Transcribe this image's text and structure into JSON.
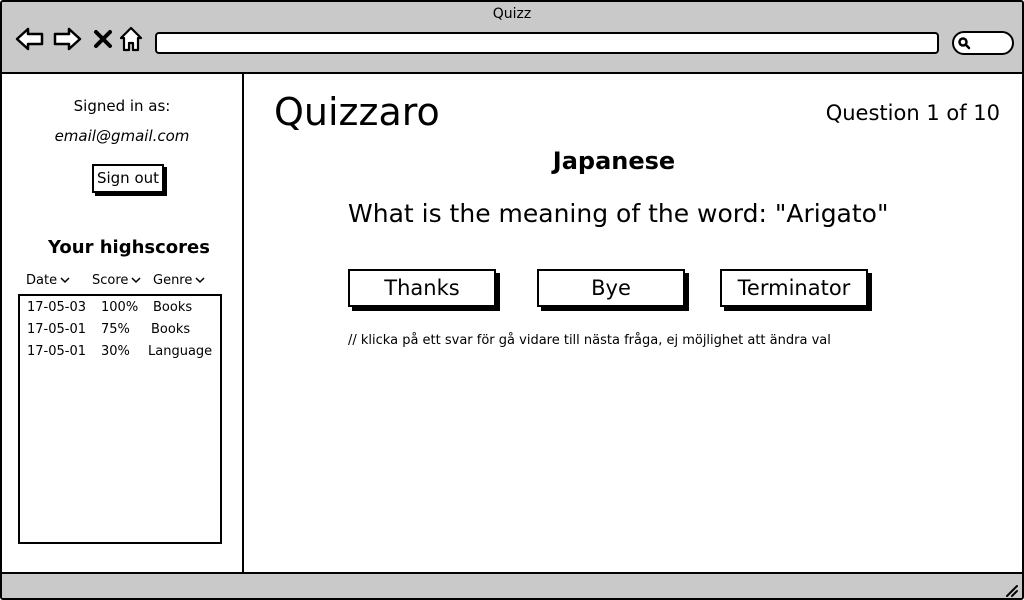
{
  "window": {
    "title": "Quizz"
  },
  "toolbar": {
    "back_icon": "arrow-left-icon",
    "forward_icon": "arrow-right-icon",
    "close_icon": "x-icon",
    "home_icon": "home-icon",
    "url": "",
    "search_icon": "search-icon"
  },
  "sidebar": {
    "signed_in_label": "Signed in as:",
    "email": "email@gmail.com",
    "sign_out_label": "Sign out",
    "highscores_title": "Your highscores",
    "columns": [
      "Date",
      "Score",
      "Genre"
    ],
    "rows": [
      {
        "date": "17-05-03",
        "score": "100%",
        "genre": "Books"
      },
      {
        "date": "17-05-01",
        "score": "75%",
        "genre": "Books"
      },
      {
        "date": "17-05-01",
        "score": "30%",
        "genre": "Language"
      }
    ]
  },
  "main": {
    "logo": "Quizzaro",
    "question_counter": "Question 1 of 10",
    "category": "Japanese",
    "question": "What is the meaning of the word: \"Arigato\"",
    "answers": [
      "Thanks",
      "Bye",
      "Terminator"
    ],
    "note": "// klicka på ett svar för gå vidare till nästa fråga, ej möjlighet att ändra val"
  },
  "colors": {
    "chrome": "#c9c9c9",
    "border": "#000000",
    "background": "#ffffff"
  }
}
